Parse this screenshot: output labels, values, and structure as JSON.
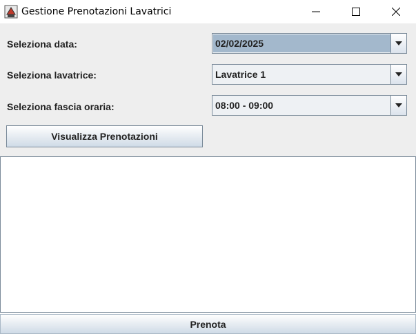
{
  "window": {
    "title": "Gestione Prenotazioni Lavatrici",
    "icons": {
      "app": "java-cup-icon",
      "minimize": "minimize-icon",
      "maximize": "maximize-icon",
      "close": "close-icon"
    }
  },
  "form": {
    "date_label": "Seleziona data:",
    "date_value": "02/02/2025",
    "machine_label": "Seleziona lavatrice:",
    "machine_value": "Lavatrice 1",
    "slot_label": "Seleziona fascia oraria:",
    "slot_value": "08:00 - 09:00"
  },
  "buttons": {
    "view_label": "Visualizza Prenotazioni",
    "book_label": "Prenota"
  },
  "output": {
    "text": ""
  },
  "colors": {
    "selected_field": "#a3b8cc",
    "panel": "#eeeeee",
    "border": "#7a8a99"
  }
}
